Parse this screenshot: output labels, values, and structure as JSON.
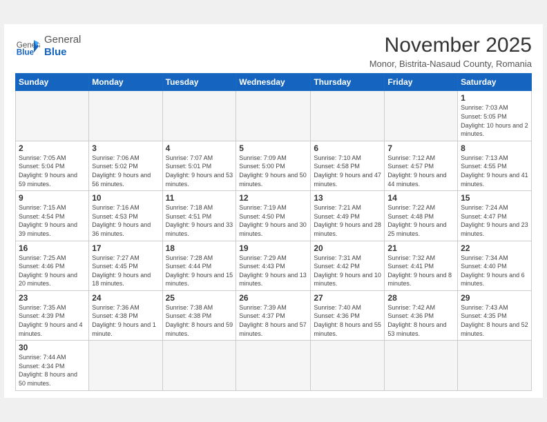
{
  "header": {
    "logo_general": "General",
    "logo_blue": "Blue",
    "month": "November 2025",
    "location": "Monor, Bistrita-Nasaud County, Romania"
  },
  "weekdays": [
    "Sunday",
    "Monday",
    "Tuesday",
    "Wednesday",
    "Thursday",
    "Friday",
    "Saturday"
  ],
  "weeks": [
    [
      {
        "day": "",
        "info": ""
      },
      {
        "day": "",
        "info": ""
      },
      {
        "day": "",
        "info": ""
      },
      {
        "day": "",
        "info": ""
      },
      {
        "day": "",
        "info": ""
      },
      {
        "day": "",
        "info": ""
      },
      {
        "day": "1",
        "info": "Sunrise: 7:03 AM\nSunset: 5:05 PM\nDaylight: 10 hours\nand 2 minutes."
      }
    ],
    [
      {
        "day": "2",
        "info": "Sunrise: 7:05 AM\nSunset: 5:04 PM\nDaylight: 9 hours\nand 59 minutes."
      },
      {
        "day": "3",
        "info": "Sunrise: 7:06 AM\nSunset: 5:02 PM\nDaylight: 9 hours\nand 56 minutes."
      },
      {
        "day": "4",
        "info": "Sunrise: 7:07 AM\nSunset: 5:01 PM\nDaylight: 9 hours\nand 53 minutes."
      },
      {
        "day": "5",
        "info": "Sunrise: 7:09 AM\nSunset: 5:00 PM\nDaylight: 9 hours\nand 50 minutes."
      },
      {
        "day": "6",
        "info": "Sunrise: 7:10 AM\nSunset: 4:58 PM\nDaylight: 9 hours\nand 47 minutes."
      },
      {
        "day": "7",
        "info": "Sunrise: 7:12 AM\nSunset: 4:57 PM\nDaylight: 9 hours\nand 44 minutes."
      },
      {
        "day": "8",
        "info": "Sunrise: 7:13 AM\nSunset: 4:55 PM\nDaylight: 9 hours\nand 41 minutes."
      }
    ],
    [
      {
        "day": "9",
        "info": "Sunrise: 7:15 AM\nSunset: 4:54 PM\nDaylight: 9 hours\nand 39 minutes."
      },
      {
        "day": "10",
        "info": "Sunrise: 7:16 AM\nSunset: 4:53 PM\nDaylight: 9 hours\nand 36 minutes."
      },
      {
        "day": "11",
        "info": "Sunrise: 7:18 AM\nSunset: 4:51 PM\nDaylight: 9 hours\nand 33 minutes."
      },
      {
        "day": "12",
        "info": "Sunrise: 7:19 AM\nSunset: 4:50 PM\nDaylight: 9 hours\nand 30 minutes."
      },
      {
        "day": "13",
        "info": "Sunrise: 7:21 AM\nSunset: 4:49 PM\nDaylight: 9 hours\nand 28 minutes."
      },
      {
        "day": "14",
        "info": "Sunrise: 7:22 AM\nSunset: 4:48 PM\nDaylight: 9 hours\nand 25 minutes."
      },
      {
        "day": "15",
        "info": "Sunrise: 7:24 AM\nSunset: 4:47 PM\nDaylight: 9 hours\nand 23 minutes."
      }
    ],
    [
      {
        "day": "16",
        "info": "Sunrise: 7:25 AM\nSunset: 4:46 PM\nDaylight: 9 hours\nand 20 minutes."
      },
      {
        "day": "17",
        "info": "Sunrise: 7:27 AM\nSunset: 4:45 PM\nDaylight: 9 hours\nand 18 minutes."
      },
      {
        "day": "18",
        "info": "Sunrise: 7:28 AM\nSunset: 4:44 PM\nDaylight: 9 hours\nand 15 minutes."
      },
      {
        "day": "19",
        "info": "Sunrise: 7:29 AM\nSunset: 4:43 PM\nDaylight: 9 hours\nand 13 minutes."
      },
      {
        "day": "20",
        "info": "Sunrise: 7:31 AM\nSunset: 4:42 PM\nDaylight: 9 hours\nand 10 minutes."
      },
      {
        "day": "21",
        "info": "Sunrise: 7:32 AM\nSunset: 4:41 PM\nDaylight: 9 hours\nand 8 minutes."
      },
      {
        "day": "22",
        "info": "Sunrise: 7:34 AM\nSunset: 4:40 PM\nDaylight: 9 hours\nand 6 minutes."
      }
    ],
    [
      {
        "day": "23",
        "info": "Sunrise: 7:35 AM\nSunset: 4:39 PM\nDaylight: 9 hours\nand 4 minutes."
      },
      {
        "day": "24",
        "info": "Sunrise: 7:36 AM\nSunset: 4:38 PM\nDaylight: 9 hours\nand 1 minute."
      },
      {
        "day": "25",
        "info": "Sunrise: 7:38 AM\nSunset: 4:38 PM\nDaylight: 8 hours\nand 59 minutes."
      },
      {
        "day": "26",
        "info": "Sunrise: 7:39 AM\nSunset: 4:37 PM\nDaylight: 8 hours\nand 57 minutes."
      },
      {
        "day": "27",
        "info": "Sunrise: 7:40 AM\nSunset: 4:36 PM\nDaylight: 8 hours\nand 55 minutes."
      },
      {
        "day": "28",
        "info": "Sunrise: 7:42 AM\nSunset: 4:36 PM\nDaylight: 8 hours\nand 53 minutes."
      },
      {
        "day": "29",
        "info": "Sunrise: 7:43 AM\nSunset: 4:35 PM\nDaylight: 8 hours\nand 52 minutes."
      }
    ],
    [
      {
        "day": "30",
        "info": "Sunrise: 7:44 AM\nSunset: 4:34 PM\nDaylight: 8 hours\nand 50 minutes."
      },
      {
        "day": "",
        "info": ""
      },
      {
        "day": "",
        "info": ""
      },
      {
        "day": "",
        "info": ""
      },
      {
        "day": "",
        "info": ""
      },
      {
        "day": "",
        "info": ""
      },
      {
        "day": "",
        "info": ""
      }
    ]
  ]
}
